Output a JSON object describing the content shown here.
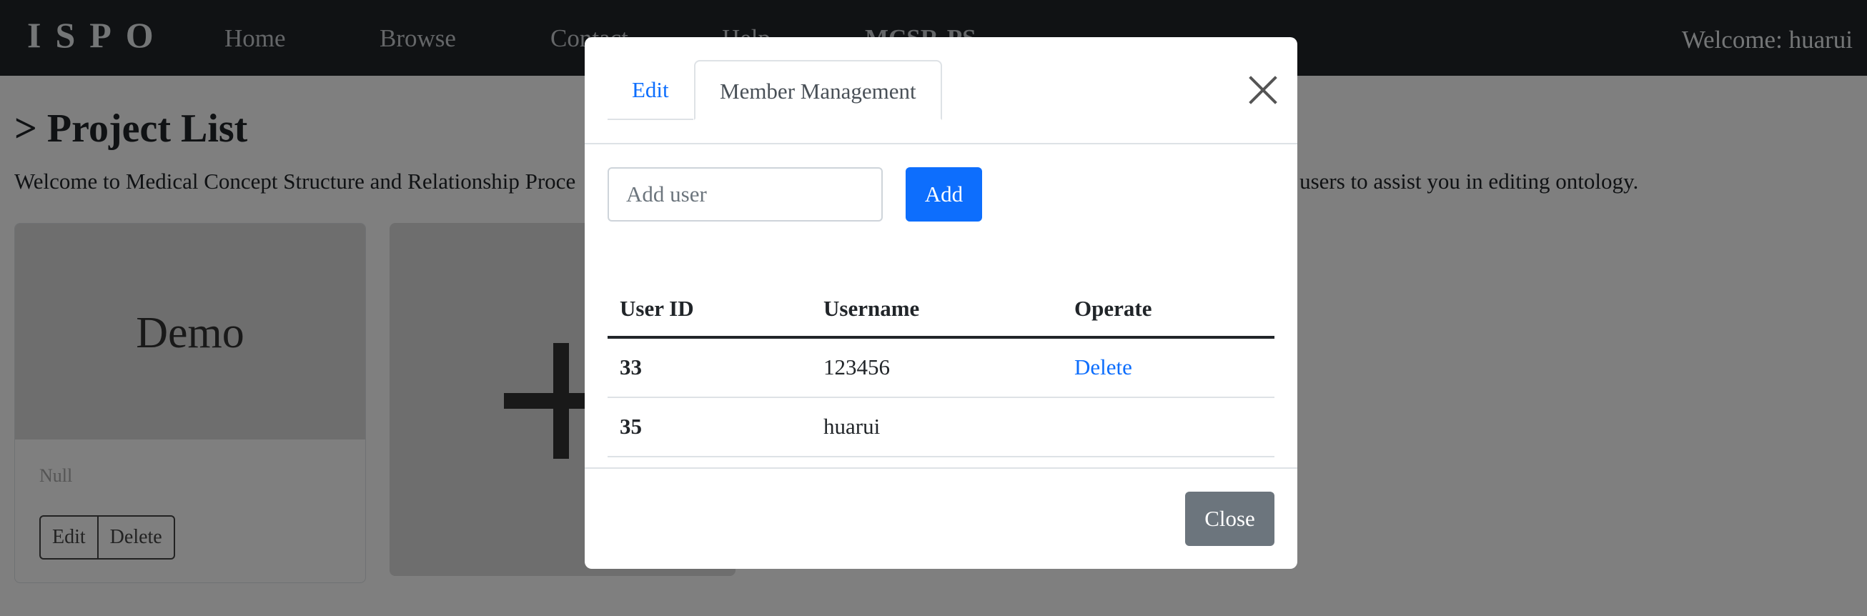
{
  "navbar": {
    "brand": "ISPO",
    "links": [
      "Home",
      "Browse",
      "Contact",
      "Help",
      "MCSR-PS"
    ],
    "welcome": "Welcome: huarui"
  },
  "page": {
    "title": "> Project List",
    "intro": "Welcome to Medical Concept Structure and Relationship Proce",
    "intro_tail": "r users to assist you in editing ontology."
  },
  "project_card": {
    "title": "Demo",
    "description": "Null",
    "edit_label": "Edit",
    "delete_label": "Delete"
  },
  "modal": {
    "tabs": [
      {
        "label": "Edit",
        "active": false
      },
      {
        "label": "Member Management",
        "active": true
      }
    ],
    "add_user": {
      "placeholder": "Add user",
      "value": "",
      "button_label": "Add"
    },
    "table": {
      "headers": [
        "User ID",
        "Username",
        "Operate"
      ],
      "rows": [
        {
          "user_id": "33",
          "username": "123456",
          "operate": "Delete"
        },
        {
          "user_id": "35",
          "username": "huarui",
          "operate": ""
        }
      ]
    },
    "footer": {
      "close_label": "Close"
    }
  },
  "colors": {
    "navbar_bg": "#212529",
    "primary": "#0d6efd",
    "secondary": "#6c757d",
    "backdrop": "rgba(0,0,0,0.5)"
  }
}
